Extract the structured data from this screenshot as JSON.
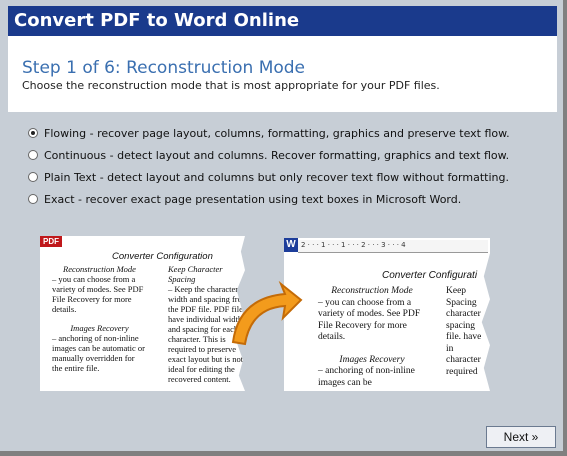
{
  "window": {
    "title": "Convert PDF to Word Online"
  },
  "header": {
    "step_title": "Step 1 of 6: Reconstruction Mode",
    "step_subtitle": "Choose the reconstruction mode that is most appropriate for your PDF files."
  },
  "options": [
    {
      "label": "Flowing - recover page layout, columns, formatting, graphics and preserve text flow.",
      "selected": true
    },
    {
      "label": "Continuous - detect layout and columns. Recover formatting, graphics and text flow.",
      "selected": false
    },
    {
      "label": "Plain Text - detect layout and columns but only recover text flow without formatting.",
      "selected": false
    },
    {
      "label": "Exact - recover exact page presentation using text boxes in Microsoft Word.",
      "selected": false
    }
  ],
  "preview": {
    "pdf_badge": "PDF",
    "word_badge": "W",
    "pdf_doc": {
      "title": "Converter Configuration",
      "col1_heading": "Reconstruction Mode",
      "col1_text": "– you can choose from a variety of modes. See PDF File Recovery for more details.",
      "col1_heading2": "Images Recovery",
      "col1_text2": "– anchoring of non-inline images can be automatic or manually overridden for the entire file.",
      "col2_heading": "Keep Character Spacing",
      "col2_text": "– Keep the character width and spacing from the PDF file. PDF files have individual width and spacing for each character. This is required to preserve exact layout but is not ideal for editing the recovered content."
    },
    "word_doc": {
      "ruler_text": "2 · · · 1 · · · 1 · · · 2 · · · 3 · · · 4",
      "title": "Converter Configurati",
      "col1_heading": "Reconstruction Mode",
      "col1_text": "– you can choose from a variety of modes. See PDF File Recovery for more details.",
      "col1_heading2": "Images Recovery",
      "col1_text2": "– anchoring of non-inline images can be",
      "col2_text": "Keep Spacing character spacing file. have in character required"
    }
  },
  "footer": {
    "next_label": "Next »"
  }
}
